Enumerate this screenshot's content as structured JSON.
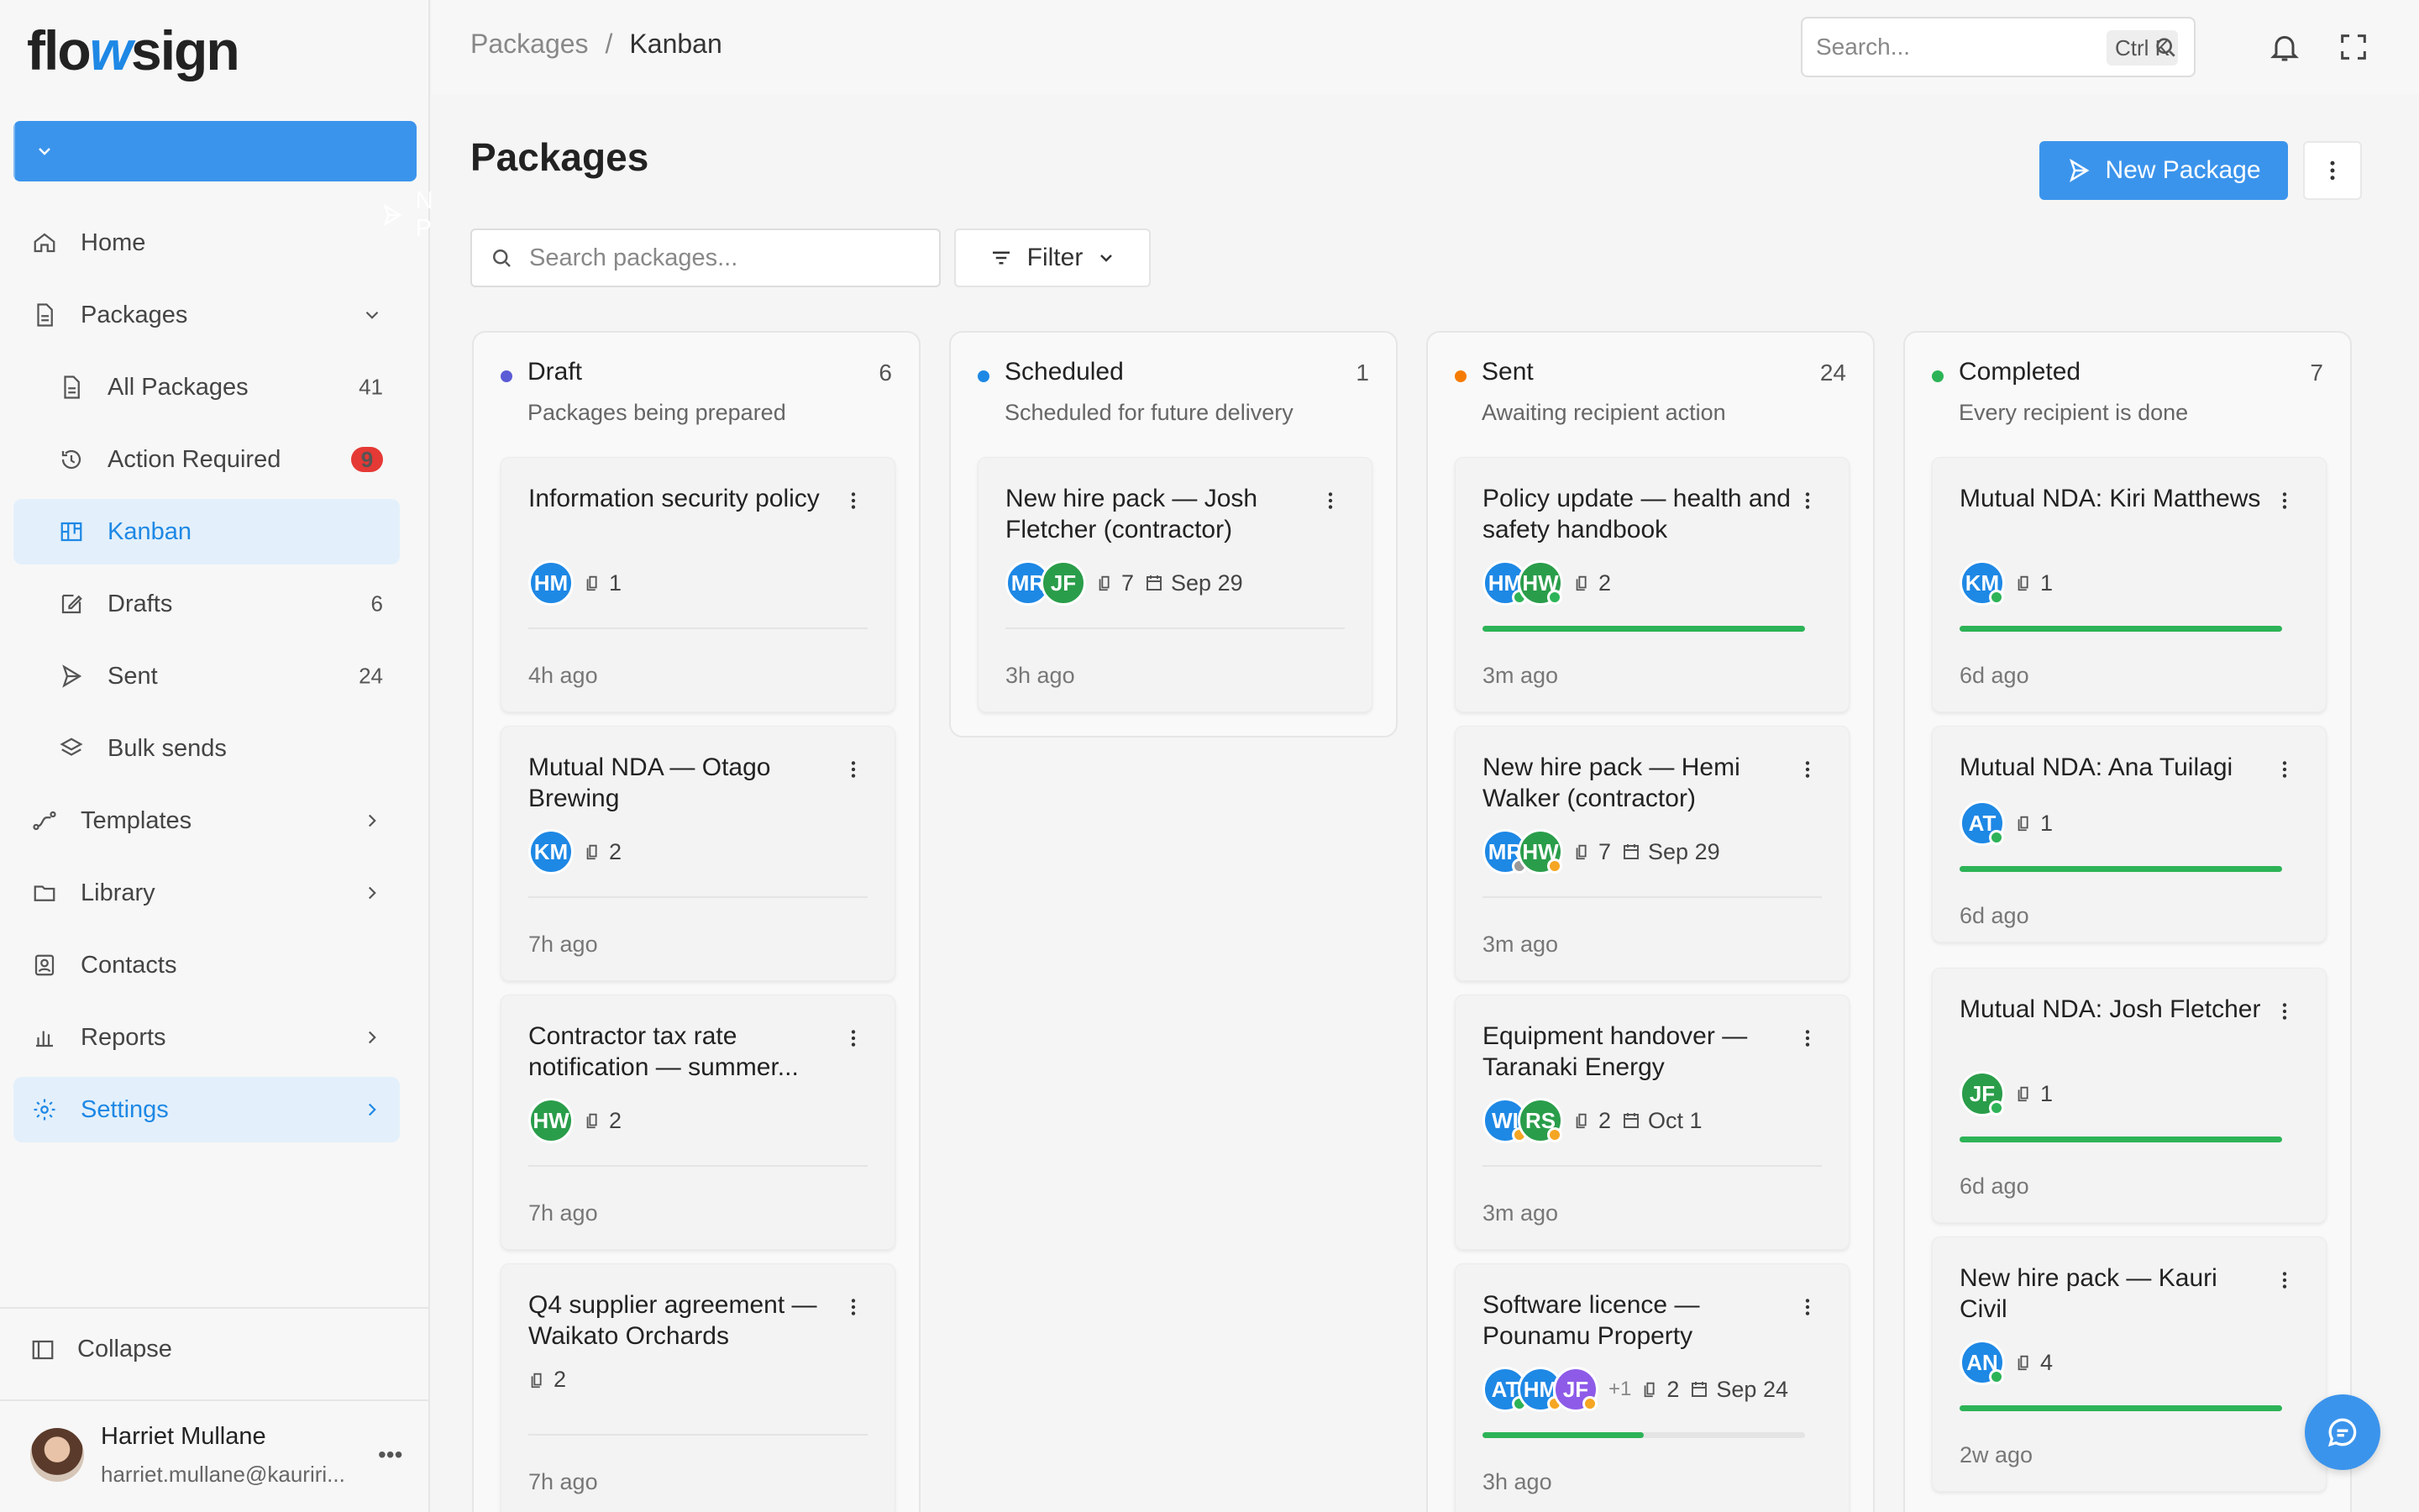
{
  "app": {
    "logo_a": "flo",
    "logo_w": "w",
    "logo_b": "sign"
  },
  "sidebar": {
    "new_button": "New Package",
    "items": [
      {
        "label": "Home",
        "icon": "home-icon"
      },
      {
        "label": "Packages",
        "icon": "file-icon"
      },
      {
        "label": "All Packages",
        "count": "41",
        "icon": "file-icon"
      },
      {
        "label": "Action Required",
        "count": "9",
        "icon": "history-icon"
      },
      {
        "label": "Kanban",
        "icon": "kanban-icon"
      },
      {
        "label": "Drafts",
        "count": "6",
        "icon": "edit-icon"
      },
      {
        "label": "Sent",
        "count": "24",
        "icon": "send-icon"
      },
      {
        "label": "Bulk sends",
        "icon": "layers-icon"
      },
      {
        "label": "Templates",
        "icon": "route-icon"
      },
      {
        "label": "Library",
        "icon": "folder-icon"
      },
      {
        "label": "Contacts",
        "icon": "contact-icon"
      },
      {
        "label": "Reports",
        "icon": "bar-chart-icon"
      },
      {
        "label": "Settings",
        "icon": "gear-icon"
      }
    ],
    "collapse": "Collapse",
    "user": {
      "name": "Harriet Mullane",
      "email": "harriet.mullane@kauriri..."
    }
  },
  "topbar": {
    "breadcrumb": [
      "Packages",
      "/",
      "Kanban"
    ],
    "search_placeholder": "Search...",
    "shortcut": "Ctrl K"
  },
  "page": {
    "title": "Packages",
    "new_button": "New Package",
    "search_placeholder": "Search packages...",
    "filter": "Filter"
  },
  "colors": {
    "draft": "#5b5bd6",
    "scheduled": "#1e88e5",
    "sent": "#f57c00",
    "completed": "#2db357",
    "accent": "#3b94ec"
  },
  "columns": [
    {
      "title": "Draft",
      "count": "6",
      "subtitle": "Packages being prepared",
      "cards": [
        {
          "title": "Information security policy",
          "avatars": [
            "HM"
          ],
          "docs": "1",
          "time": "4h ago"
        },
        {
          "title": "Mutual NDA — Otago Brewing",
          "avatars": [
            "KM"
          ],
          "docs": "2",
          "time": "7h ago"
        },
        {
          "title": "Contractor tax rate notification — summer...",
          "avatars": [
            "HW"
          ],
          "docs": "2",
          "time": "7h ago"
        },
        {
          "title": "Q4 supplier agreement — Waikato Orchards",
          "avatars": [],
          "docs": "2",
          "time": "7h ago"
        }
      ]
    },
    {
      "title": "Scheduled",
      "count": "1",
      "subtitle": "Scheduled for future delivery",
      "cards": [
        {
          "title": "New hire pack — Josh Fletcher (contractor)",
          "avatars": [
            "MR",
            "JF"
          ],
          "docs": "7",
          "date": "Sep 29",
          "time": "3h ago"
        }
      ]
    },
    {
      "title": "Sent",
      "count": "24",
      "subtitle": "Awaiting recipient action",
      "cards": [
        {
          "title": "Policy update — health and safety handbook",
          "avatars": [
            "HM",
            "HW"
          ],
          "docs": "2",
          "progress": 1.0,
          "time": "3m ago"
        },
        {
          "title": "New hire pack — Hemi Walker (contractor)",
          "avatars": [
            "MR",
            "HW"
          ],
          "docs": "7",
          "date": "Sep 29",
          "time": "3m ago"
        },
        {
          "title": "Equipment handover — Taranaki Energy",
          "avatars": [
            "WI",
            "RS"
          ],
          "docs": "2",
          "date": "Oct 1",
          "time": "3m ago"
        },
        {
          "title": "Software licence — Pounamu Property",
          "avatars": [
            "AT",
            "HM",
            "JF"
          ],
          "extra": "+1",
          "docs": "2",
          "date": "Sep 24",
          "progress": 0.5,
          "time": "3h ago"
        }
      ]
    },
    {
      "title": "Completed",
      "count": "7",
      "subtitle": "Every recipient is done",
      "cards": [
        {
          "title": "Mutual NDA: Kiri Matthews",
          "avatars": [
            "KM"
          ],
          "docs": "1",
          "progress": 1.0,
          "time": "6d ago"
        },
        {
          "title": "Mutual NDA: Ana Tuilagi",
          "avatars": [
            "AT"
          ],
          "docs": "1",
          "progress": 1.0,
          "time": "6d ago"
        },
        {
          "title": "Mutual NDA: Josh Fletcher",
          "avatars": [
            "JF"
          ],
          "docs": "1",
          "progress": 1.0,
          "time": "6d ago"
        },
        {
          "title": "New hire pack — Kauri Civil",
          "avatars": [
            "AN"
          ],
          "docs": "4",
          "progress": 1.0,
          "time": "2w ago"
        }
      ]
    }
  ]
}
